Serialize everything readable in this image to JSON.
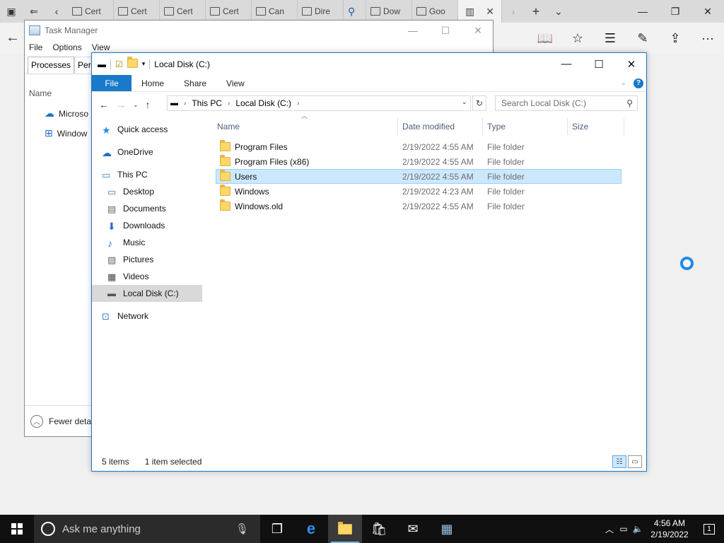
{
  "edge": {
    "tabs": [
      "Cert",
      "Cert",
      "Cert",
      "Cert",
      "Can",
      "Dire",
      "Dow",
      "Goo"
    ],
    "icons": [
      "tab-preview-icon",
      "set-aside-icon",
      "back-icon",
      "reading-view-icon",
      "favorite-star-icon",
      "hub-icon",
      "pen-icon",
      "share-icon",
      "more-icon"
    ]
  },
  "task_manager": {
    "title": "Task Manager",
    "menu": [
      "File",
      "Options",
      "View"
    ],
    "tabs": [
      "Processes",
      "Perfo"
    ],
    "column_name": "Name",
    "rows": [
      "Microso",
      "Window"
    ],
    "footer": "Fewer detai"
  },
  "explorer": {
    "title": "Local Disk (C:)",
    "ribbon": {
      "file": "File",
      "home": "Home",
      "share": "Share",
      "view": "View",
      "help": "?"
    },
    "address": {
      "root": "This PC",
      "current": "Local Disk (C:)"
    },
    "search_placeholder": "Search Local Disk (C:)",
    "nav": [
      {
        "label": "Quick access",
        "icon": "star-icon"
      },
      {
        "label": "OneDrive",
        "icon": "cloud-icon"
      },
      {
        "label": "This PC",
        "icon": "computer-icon"
      },
      {
        "label": "Desktop",
        "icon": "desktop-icon"
      },
      {
        "label": "Documents",
        "icon": "documents-icon"
      },
      {
        "label": "Downloads",
        "icon": "downloads-icon"
      },
      {
        "label": "Music",
        "icon": "music-icon"
      },
      {
        "label": "Pictures",
        "icon": "pictures-icon"
      },
      {
        "label": "Videos",
        "icon": "videos-icon"
      },
      {
        "label": "Local Disk (C:)",
        "icon": "drive-icon"
      },
      {
        "label": "Network",
        "icon": "network-icon"
      }
    ],
    "columns": {
      "name": "Name",
      "date": "Date modified",
      "type": "Type",
      "size": "Size"
    },
    "files": [
      {
        "name": "Program Files",
        "date": "2/19/2022 4:55 AM",
        "type": "File folder"
      },
      {
        "name": "Program Files (x86)",
        "date": "2/19/2022 4:55 AM",
        "type": "File folder"
      },
      {
        "name": "Users",
        "date": "2/19/2022 4:55 AM",
        "type": "File folder"
      },
      {
        "name": "Windows",
        "date": "2/19/2022 4:23 AM",
        "type": "File folder"
      },
      {
        "name": "Windows.old",
        "date": "2/19/2022 4:55 AM",
        "type": "File folder"
      }
    ],
    "selected_file": "Users",
    "status": {
      "count": "5 items",
      "selection": "1 item selected"
    }
  },
  "taskbar": {
    "search_placeholder": "Ask me anything",
    "time": "4:56 AM",
    "date": "2/19/2022",
    "notification_count": "1"
  },
  "colors": {
    "accent": "#1979ca",
    "selection": "#cce8ff",
    "taskbar": "#101010"
  }
}
